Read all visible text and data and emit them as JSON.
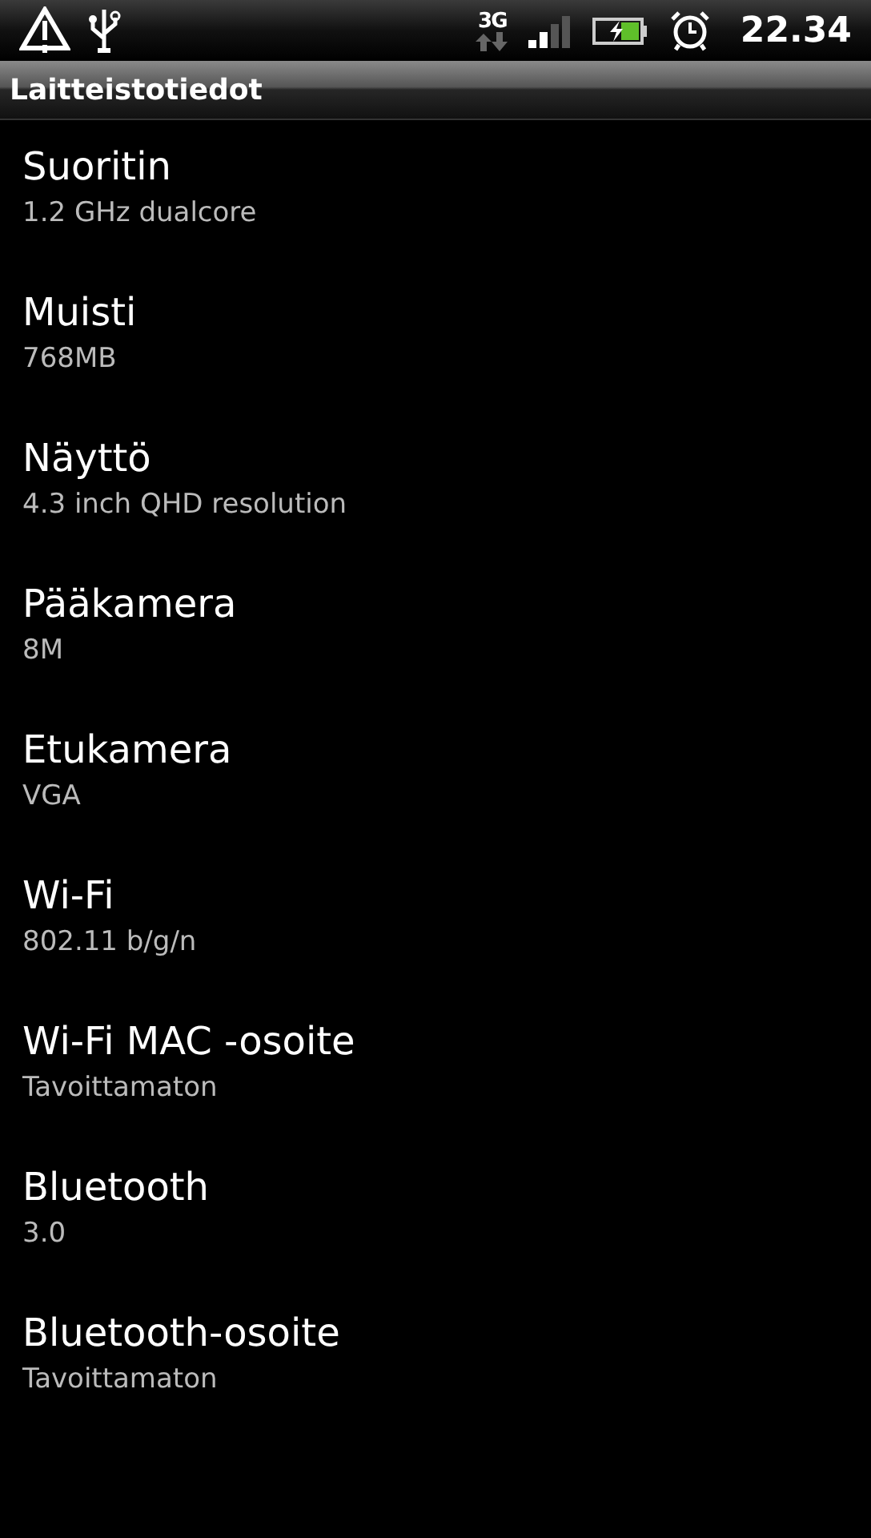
{
  "status_bar": {
    "network_type": "3G",
    "time": "22.34"
  },
  "title_bar": {
    "title": "Laitteistotiedot"
  },
  "items": [
    {
      "title": "Suoritin",
      "value": "1.2 GHz dualcore"
    },
    {
      "title": "Muisti",
      "value": "768MB"
    },
    {
      "title": "Näyttö",
      "value": "4.3 inch QHD resolution"
    },
    {
      "title": "Pääkamera",
      "value": "8M"
    },
    {
      "title": "Etukamera",
      "value": "VGA"
    },
    {
      "title": "Wi-Fi",
      "value": "802.11 b/g/n"
    },
    {
      "title": "Wi-Fi MAC -osoite",
      "value": "Tavoittamaton"
    },
    {
      "title": "Bluetooth",
      "value": "3.0"
    },
    {
      "title": "Bluetooth-osoite",
      "value": "Tavoittamaton"
    }
  ]
}
